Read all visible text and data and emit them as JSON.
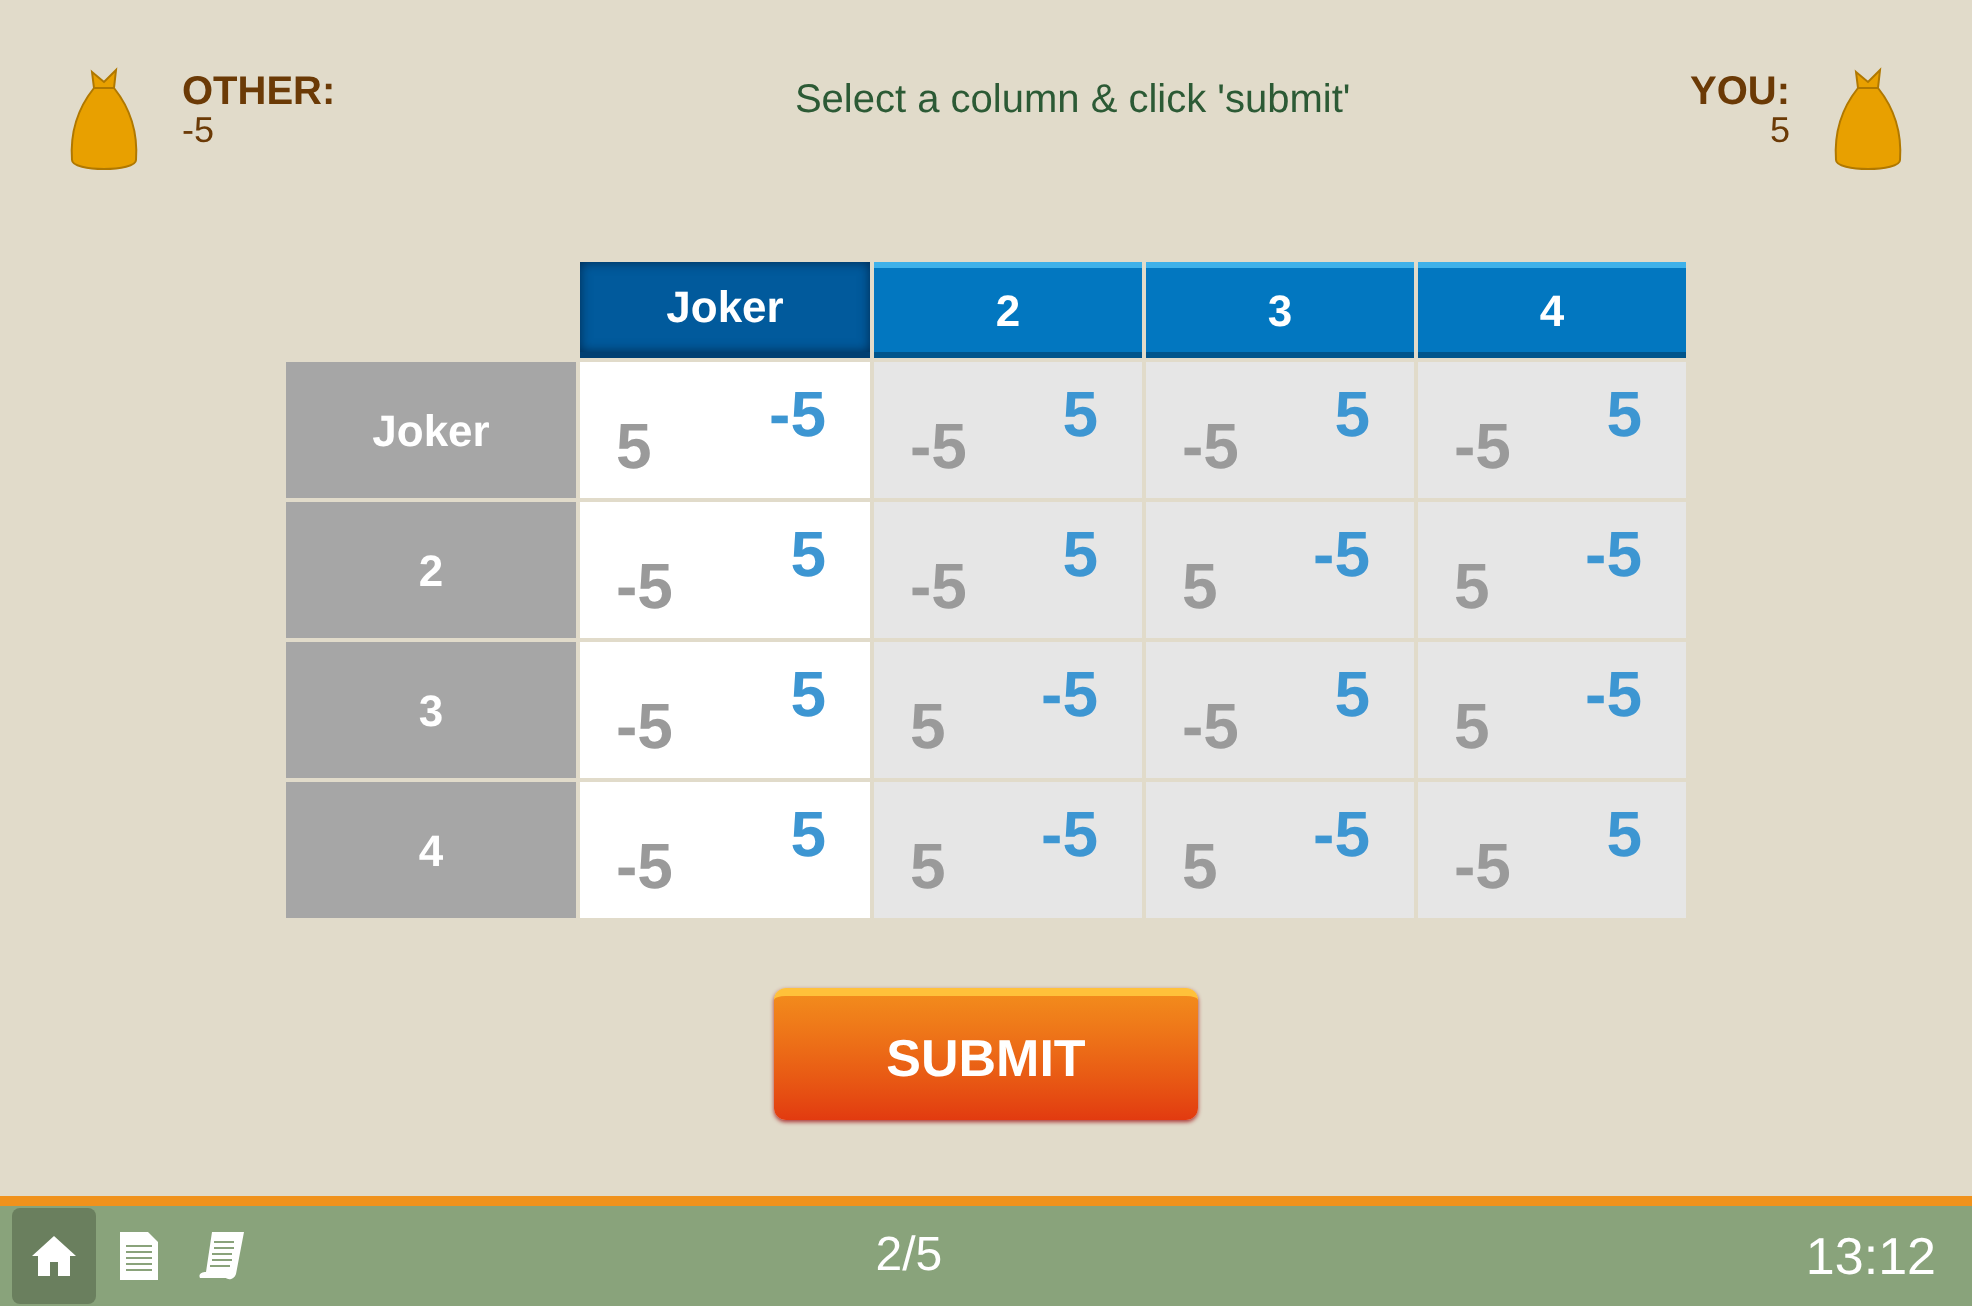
{
  "header": {
    "other": {
      "label": "OTHER:",
      "value": "-5"
    },
    "instruction": "Select a column & click 'submit'",
    "you": {
      "label": "YOU:",
      "value": "5"
    }
  },
  "table": {
    "columns": [
      {
        "label": "Joker",
        "selected": true
      },
      {
        "label": "2",
        "selected": false
      },
      {
        "label": "3",
        "selected": false
      },
      {
        "label": "4",
        "selected": false
      }
    ],
    "rows": [
      {
        "label": "Joker",
        "cells": [
          {
            "lower_value": "5",
            "upper_value": "-5"
          },
          {
            "lower_value": "-5",
            "upper_value": "5"
          },
          {
            "lower_value": "-5",
            "upper_value": "5"
          },
          {
            "lower_value": "-5",
            "upper_value": "5"
          }
        ]
      },
      {
        "label": "2",
        "cells": [
          {
            "lower_value": "-5",
            "upper_value": "5"
          },
          {
            "lower_value": "-5",
            "upper_value": "5"
          },
          {
            "lower_value": "5",
            "upper_value": "-5"
          },
          {
            "lower_value": "5",
            "upper_value": "-5"
          }
        ]
      },
      {
        "label": "3",
        "cells": [
          {
            "lower_value": "-5",
            "upper_value": "5"
          },
          {
            "lower_value": "5",
            "upper_value": "-5"
          },
          {
            "lower_value": "-5",
            "upper_value": "5"
          },
          {
            "lower_value": "5",
            "upper_value": "-5"
          }
        ]
      },
      {
        "label": "4",
        "cells": [
          {
            "lower_value": "-5",
            "upper_value": "5"
          },
          {
            "lower_value": "5",
            "upper_value": "-5"
          },
          {
            "lower_value": "5",
            "upper_value": "-5"
          },
          {
            "lower_value": "-5",
            "upper_value": "5"
          }
        ]
      }
    ]
  },
  "submit": "SUBMIT",
  "footer": {
    "icons": [
      {
        "kind": "home",
        "selected": true
      },
      {
        "kind": "document",
        "selected": false
      },
      {
        "kind": "scroll",
        "selected": false
      }
    ],
    "progress": "2/5",
    "time": "13:12"
  }
}
